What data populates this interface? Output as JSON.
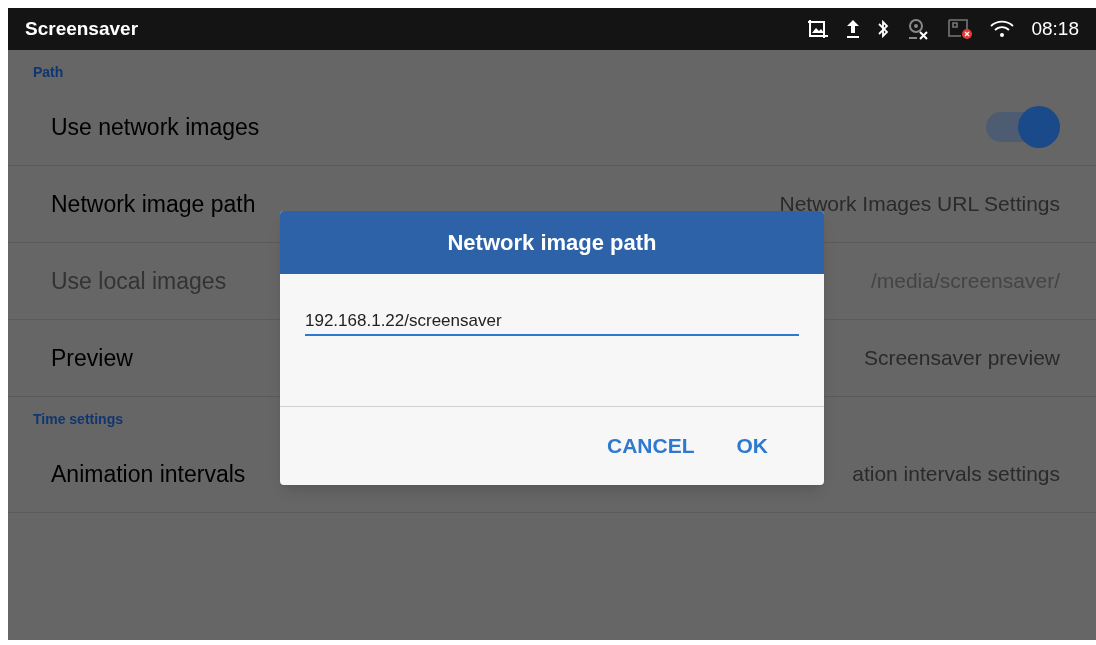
{
  "status_bar": {
    "title": "Screensaver",
    "time": "08:18"
  },
  "sections": [
    {
      "header": "Path",
      "rows": [
        {
          "kind": "switch",
          "title": "Use network images",
          "on": true,
          "disabled": false
        },
        {
          "kind": "text",
          "title": "Network image path",
          "summary": "Network Images URL Settings",
          "disabled": false
        },
        {
          "kind": "text",
          "title": "Use local images",
          "summary": "/media/screensaver/",
          "disabled": true
        },
        {
          "kind": "text",
          "title": "Preview",
          "summary": "Screensaver preview",
          "disabled": false
        }
      ]
    },
    {
      "header": "Time settings",
      "rows": [
        {
          "kind": "text",
          "title": "Animation intervals",
          "summary": "ation intervals settings",
          "disabled": false
        }
      ]
    }
  ],
  "dialog": {
    "title": "Network image path",
    "value": "192.168.1.22/screensaver",
    "buttons": [
      "CANCEL",
      "OK"
    ]
  }
}
